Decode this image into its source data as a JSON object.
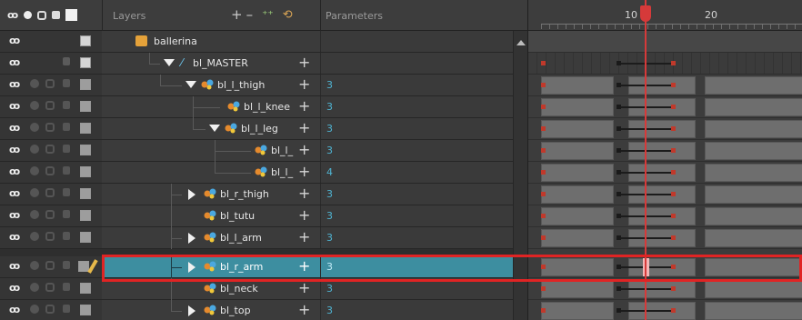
{
  "panels": {
    "layers_title": "Layers",
    "parameters_title": "Parameters"
  },
  "timeline": {
    "frame_labels": [
      "10",
      "20"
    ]
  },
  "layers": [
    {
      "name": "ballerina",
      "param": ""
    },
    {
      "name": "bl_MASTER",
      "param": ""
    },
    {
      "name": "bl_l_thigh",
      "param": "3"
    },
    {
      "name": "bl_l_knee",
      "param": "3"
    },
    {
      "name": "bl_l_leg",
      "param": "3"
    },
    {
      "name": "bl_l_",
      "param": "3"
    },
    {
      "name": "bl_l_",
      "param": "4"
    },
    {
      "name": "bl_r_thigh",
      "param": "3"
    },
    {
      "name": "bl_tutu",
      "param": "3"
    },
    {
      "name": "bl_l_arm",
      "param": "3"
    },
    {
      "name": "bl_r_arm",
      "param": "3"
    },
    {
      "name": "bl_neck",
      "param": "3"
    },
    {
      "name": "bl_top",
      "param": "3"
    }
  ],
  "colors": {
    "selection": "#e02424",
    "playhead": "#d63a3a",
    "highlight_row": "#3d8ea0",
    "param_text": "#4fb3d1"
  }
}
